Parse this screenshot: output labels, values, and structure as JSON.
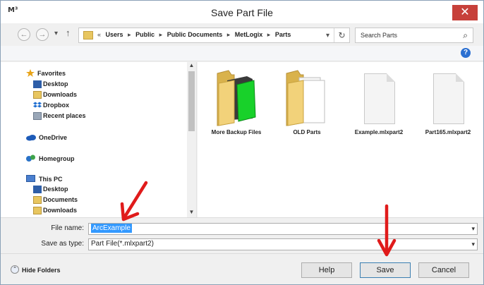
{
  "window": {
    "title": "Save Part File",
    "app_icon": "M³",
    "close_glyph": "✕"
  },
  "nav": {
    "back_glyph": "←",
    "forward_glyph": "→",
    "recent_glyph": "▾",
    "up_glyph": "↑"
  },
  "address": {
    "overflow": "«",
    "crumbs": [
      "Users",
      "Public",
      "Public Documents",
      "MetLogix",
      "Parts"
    ],
    "separator": "▸",
    "dropdown_glyph": "▾",
    "refresh_glyph": "↻"
  },
  "search": {
    "placeholder": "Search Parts",
    "icon": "⌕"
  },
  "toolbar": {
    "help_glyph": "?"
  },
  "sidebar": {
    "favorites": {
      "label": "Favorites",
      "items": [
        "Desktop",
        "Downloads",
        "Dropbox",
        "Recent places"
      ]
    },
    "onedrive": "OneDrive",
    "homegroup": "Homegroup",
    "thispc": {
      "label": "This PC",
      "items": [
        "Desktop",
        "Documents",
        "Downloads"
      ]
    }
  },
  "files": [
    {
      "name": "More Backup Files",
      "type": "folder-green"
    },
    {
      "name": "OLD Parts",
      "type": "folder-docs"
    },
    {
      "name": "Example.mlxpart2",
      "type": "file"
    },
    {
      "name": "Part165.mlxpart2",
      "type": "file"
    }
  ],
  "form": {
    "filename_label": "File name:",
    "filename_value": "ArcExample",
    "savetype_label": "Save as type:",
    "savetype_value": "Part File(*.mlxpart2)",
    "dropdown_glyph": "▾"
  },
  "footer": {
    "hide_folders": "Hide Folders",
    "hide_glyph": "⌃",
    "help": "Help",
    "save": "Save",
    "cancel": "Cancel"
  },
  "colors": {
    "selection": "#3399ff",
    "close_button": "#c7403a",
    "annotation_arrow": "#e01b1b"
  }
}
